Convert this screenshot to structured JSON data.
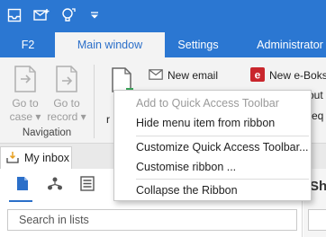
{
  "titlebar": {
    "icons": [
      "inbox-icon",
      "new-message-icon",
      "lightbulb-refresh-icon",
      "customize-dropdown-icon"
    ],
    "colors": {
      "bar": "#2b77d2"
    }
  },
  "tabs": [
    {
      "label": "F2",
      "active": false
    },
    {
      "label": "Main window",
      "active": true
    },
    {
      "label": "Settings",
      "active": false
    },
    {
      "label": "Administrator",
      "active": false
    }
  ],
  "ribbon": {
    "navigation": {
      "goto_case": {
        "line1": "Go to",
        "line2": "case ▾"
      },
      "goto_record": {
        "line1": "Go to",
        "line2": "record ▾"
      },
      "group_label": "Navigation"
    },
    "partial_label": "r",
    "new_email": "New email",
    "new_eboks": "New e-Boks",
    "partial_out": "out",
    "partial_req": "req"
  },
  "context_menu": {
    "items": [
      {
        "label": "Add to Quick Access Toolbar",
        "enabled": false
      },
      {
        "label": "Hide menu item from ribbon",
        "enabled": true
      },
      {
        "label": "Customize Quick Access Toolbar...",
        "enabled": true
      },
      {
        "label": "Customise ribbon ...",
        "enabled": true
      },
      {
        "label": "Collapse the Ribbon",
        "enabled": true
      }
    ]
  },
  "panel": {
    "tab_label": "My inbox",
    "search_placeholder": "Search in lists",
    "right_partial": "Sh"
  }
}
